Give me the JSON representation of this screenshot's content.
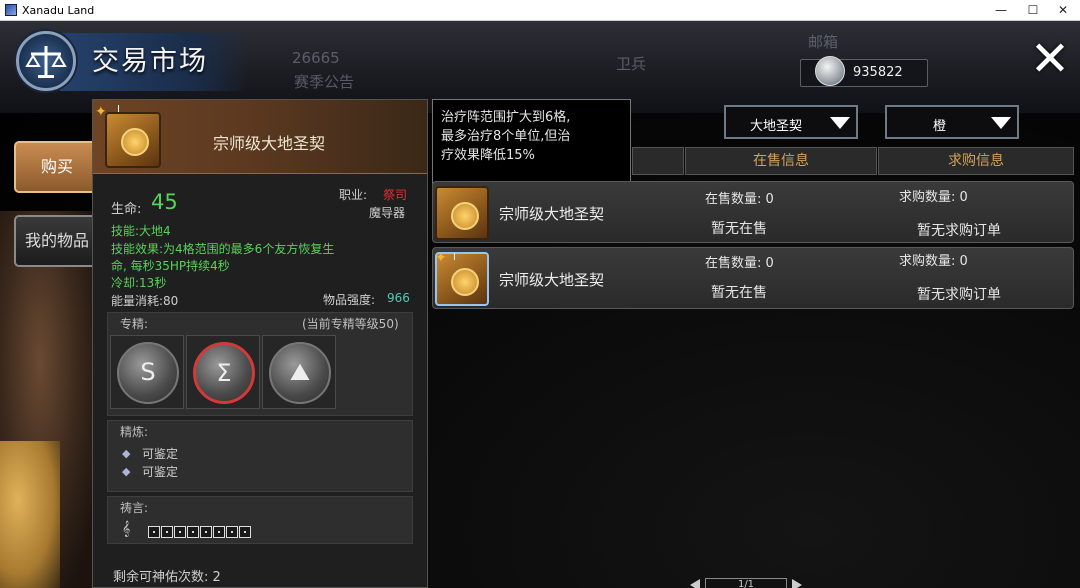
{
  "window": {
    "title": "Xanadu Land",
    "min": "—",
    "max": "☐",
    "close": "✕"
  },
  "header": {
    "title": "交易市场",
    "bg_texts": {
      "n1": "26665",
      "n2": "赛季公告",
      "mail": "邮箱",
      "guard": "卫兵"
    },
    "currency": {
      "amount": "935822",
      "icon": "silver-coin-icon"
    },
    "close_icon": "✕"
  },
  "sidebar": {
    "tabs": [
      {
        "label": "购买",
        "active": true
      },
      {
        "label": "我的物品",
        "active": false
      }
    ]
  },
  "item_detail": {
    "tier": "I",
    "name": "宗师级大地圣契",
    "hp_label": "生命:",
    "hp_value": "45",
    "class_label": "职业:",
    "class_value": "祭司",
    "item_type": "魔导器",
    "skill": "技能:大地4",
    "effect_line1": "技能效果:为4格范围的最多6个友方恢复生",
    "effect_line2": "命, 每秒35HP持续4秒",
    "cooldown": "冷却:13秒",
    "energy": "能量消耗:80",
    "strength_label": "物品强度:",
    "strength_value": "966",
    "specialization": {
      "title": "专精:",
      "level_text": "(当前专精等级50)",
      "icons": [
        "S",
        "Σ",
        "⛰"
      ],
      "selected_index": 1
    },
    "refine": {
      "title": "精炼:",
      "items": [
        "可鉴定",
        "可鉴定"
      ]
    },
    "prayer": {
      "title": "祷言:",
      "glyph": "𝄞",
      "slots": 8
    },
    "blessing_text": "剩余可神佑次数: 2"
  },
  "tooltip": {
    "lines": [
      "治疗阵范围扩大到6格,",
      "最多治疗8个单位,但治",
      "疗效果降低15%"
    ]
  },
  "filters": {
    "category": "大地圣契",
    "rarity": "橙"
  },
  "table": {
    "columns": [
      "在售信息",
      "求购信息"
    ],
    "rows": [
      {
        "tier": "I",
        "name": "宗师级大地圣契",
        "sell_count": "在售数量: 0",
        "buy_count": "求购数量: 0",
        "sell_status": "暂无在售",
        "buy_status": "暂无求购订单"
      },
      {
        "tier": "I",
        "name": "宗师级大地圣契",
        "sell_count": "在售数量: 0",
        "buy_count": "求购数量: 0",
        "sell_status": "暂无在售",
        "buy_status": "暂无求购订单"
      }
    ]
  },
  "pagination": {
    "text": "1/1"
  },
  "colors": {
    "accent_orange": "#d2a35b",
    "red": "#e03030",
    "green": "#58d25a",
    "cyan": "#58c8b8"
  }
}
